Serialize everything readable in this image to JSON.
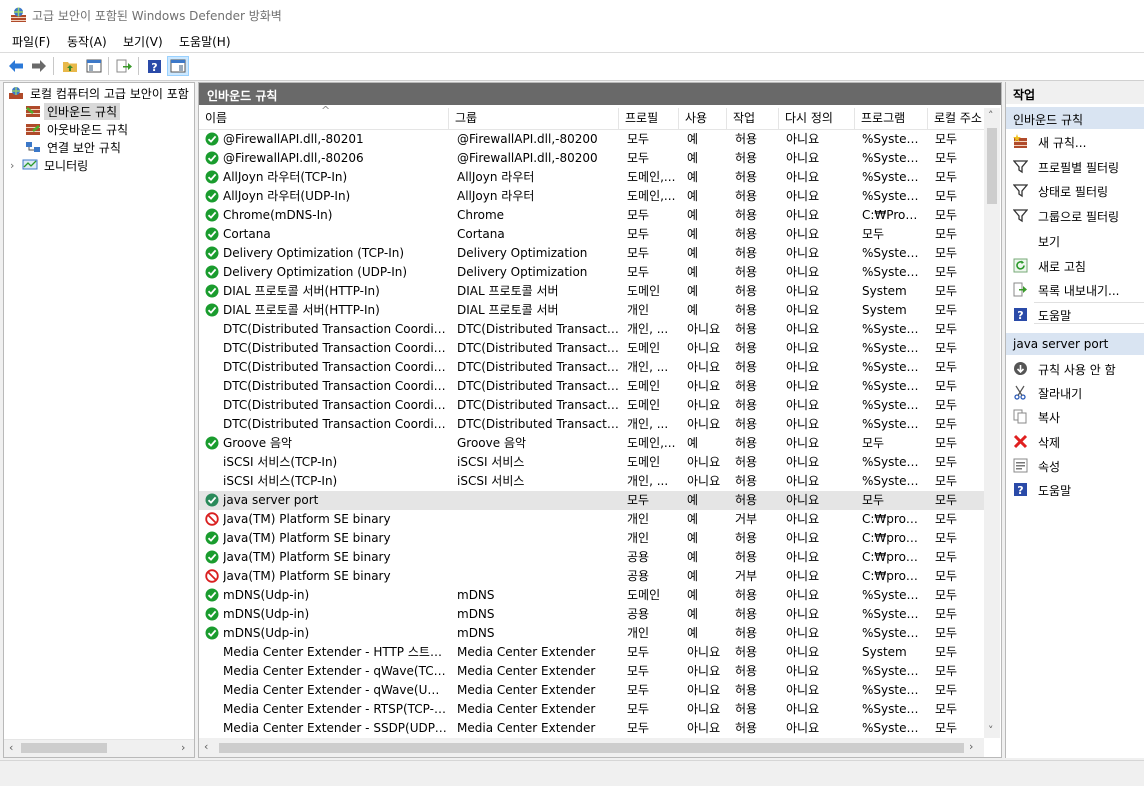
{
  "window": {
    "title": "고급 보안이 포함된 Windows Defender 방화벽"
  },
  "menu": [
    {
      "key": "file",
      "label": "파일(F)"
    },
    {
      "key": "action",
      "label": "동작(A)"
    },
    {
      "key": "view",
      "label": "보기(V)"
    },
    {
      "key": "help",
      "label": "도움말(H)"
    }
  ],
  "tree": {
    "root": "로컬 컴퓨터의 고급 보안이 포함",
    "items": [
      {
        "key": "inbound",
        "label": "인바운드 규칙",
        "selected": true
      },
      {
        "key": "outbound",
        "label": "아웃바운드 규칙"
      },
      {
        "key": "connection",
        "label": "연결 보안 규칙"
      },
      {
        "key": "monitoring",
        "label": "모니터링"
      }
    ]
  },
  "center": {
    "title": "인바운드 규칙",
    "columns": [
      {
        "key": "name",
        "label": "이름"
      },
      {
        "key": "group",
        "label": "그룹"
      },
      {
        "key": "profile",
        "label": "프로필"
      },
      {
        "key": "enabled",
        "label": "사용"
      },
      {
        "key": "action",
        "label": "작업"
      },
      {
        "key": "override",
        "label": "다시 정의"
      },
      {
        "key": "program",
        "label": "프로그램"
      },
      {
        "key": "local",
        "label": "로컬 주소"
      }
    ],
    "rows": [
      {
        "s": "ok",
        "name": "@FirewallAPI.dll,-80201",
        "group": "@FirewallAPI.dll,-80200",
        "profile": "모두",
        "enabled": "예",
        "action": "허용",
        "override": "아니요",
        "program": "%System...",
        "local": "모두"
      },
      {
        "s": "ok",
        "name": "@FirewallAPI.dll,-80206",
        "group": "@FirewallAPI.dll,-80200",
        "profile": "모두",
        "enabled": "예",
        "action": "허용",
        "override": "아니요",
        "program": "%System...",
        "local": "모두"
      },
      {
        "s": "ok",
        "name": "AllJoyn 라우터(TCP-In)",
        "group": "AllJoyn 라우터",
        "profile": "도메인,...",
        "enabled": "예",
        "action": "허용",
        "override": "아니요",
        "program": "%System...",
        "local": "모두"
      },
      {
        "s": "ok",
        "name": "AllJoyn 라우터(UDP-In)",
        "group": "AllJoyn 라우터",
        "profile": "도메인,...",
        "enabled": "예",
        "action": "허용",
        "override": "아니요",
        "program": "%System...",
        "local": "모두"
      },
      {
        "s": "ok",
        "name": "Chrome(mDNS-In)",
        "group": "Chrome",
        "profile": "모두",
        "enabled": "예",
        "action": "허용",
        "override": "아니요",
        "program": "C:₩Progr...",
        "local": "모두"
      },
      {
        "s": "ok",
        "name": "Cortana",
        "group": "Cortana",
        "profile": "모두",
        "enabled": "예",
        "action": "허용",
        "override": "아니요",
        "program": "모두",
        "local": "모두"
      },
      {
        "s": "ok",
        "name": "Delivery Optimization (TCP-In)",
        "group": "Delivery Optimization",
        "profile": "모두",
        "enabled": "예",
        "action": "허용",
        "override": "아니요",
        "program": "%System...",
        "local": "모두"
      },
      {
        "s": "ok",
        "name": "Delivery Optimization (UDP-In)",
        "group": "Delivery Optimization",
        "profile": "모두",
        "enabled": "예",
        "action": "허용",
        "override": "아니요",
        "program": "%System...",
        "local": "모두"
      },
      {
        "s": "ok",
        "name": "DIAL 프로토콜 서버(HTTP-In)",
        "group": "DIAL 프로토콜 서버",
        "profile": "도메인",
        "enabled": "예",
        "action": "허용",
        "override": "아니요",
        "program": "System",
        "local": "모두"
      },
      {
        "s": "ok",
        "name": "DIAL 프로토콜 서버(HTTP-In)",
        "group": "DIAL 프로토콜 서버",
        "profile": "개인",
        "enabled": "예",
        "action": "허용",
        "override": "아니요",
        "program": "System",
        "local": "모두"
      },
      {
        "s": "none",
        "name": "DTC(Distributed Transaction Coordinato...",
        "group": "DTC(Distributed Transactio...",
        "profile": "개인, ...",
        "enabled": "아니요",
        "action": "허용",
        "override": "아니요",
        "program": "%System...",
        "local": "모두"
      },
      {
        "s": "none",
        "name": "DTC(Distributed Transaction Coordinato...",
        "group": "DTC(Distributed Transactio...",
        "profile": "도메인",
        "enabled": "아니요",
        "action": "허용",
        "override": "아니요",
        "program": "%System...",
        "local": "모두"
      },
      {
        "s": "none",
        "name": "DTC(Distributed Transaction Coordinato...",
        "group": "DTC(Distributed Transactio...",
        "profile": "개인, ...",
        "enabled": "아니요",
        "action": "허용",
        "override": "아니요",
        "program": "%System...",
        "local": "모두"
      },
      {
        "s": "none",
        "name": "DTC(Distributed Transaction Coordinato...",
        "group": "DTC(Distributed Transactio...",
        "profile": "도메인",
        "enabled": "아니요",
        "action": "허용",
        "override": "아니요",
        "program": "%System...",
        "local": "모두"
      },
      {
        "s": "none",
        "name": "DTC(Distributed Transaction Coordinato...",
        "group": "DTC(Distributed Transactio...",
        "profile": "도메인",
        "enabled": "아니요",
        "action": "허용",
        "override": "아니요",
        "program": "%System...",
        "local": "모두"
      },
      {
        "s": "none",
        "name": "DTC(Distributed Transaction Coordinato...",
        "group": "DTC(Distributed Transactio...",
        "profile": "개인, ...",
        "enabled": "아니요",
        "action": "허용",
        "override": "아니요",
        "program": "%System...",
        "local": "모두"
      },
      {
        "s": "ok",
        "name": "Groove 음악",
        "group": "Groove 음악",
        "profile": "도메인,...",
        "enabled": "예",
        "action": "허용",
        "override": "아니요",
        "program": "모두",
        "local": "모두"
      },
      {
        "s": "none",
        "name": "iSCSI 서비스(TCP-In)",
        "group": "iSCSI 서비스",
        "profile": "도메인",
        "enabled": "아니요",
        "action": "허용",
        "override": "아니요",
        "program": "%System...",
        "local": "모두"
      },
      {
        "s": "none",
        "name": "iSCSI 서비스(TCP-In)",
        "group": "iSCSI 서비스",
        "profile": "개인, ...",
        "enabled": "아니요",
        "action": "허용",
        "override": "아니요",
        "program": "%System...",
        "local": "모두"
      },
      {
        "s": "sel",
        "name": "java server port",
        "group": "",
        "profile": "모두",
        "enabled": "예",
        "action": "허용",
        "override": "아니요",
        "program": "모두",
        "local": "모두"
      },
      {
        "s": "block",
        "name": "Java(TM) Platform SE binary",
        "group": "",
        "profile": "개인",
        "enabled": "예",
        "action": "거부",
        "override": "아니요",
        "program": "C:₩progr...",
        "local": "모두"
      },
      {
        "s": "ok",
        "name": "Java(TM) Platform SE binary",
        "group": "",
        "profile": "개인",
        "enabled": "예",
        "action": "허용",
        "override": "아니요",
        "program": "C:₩progr...",
        "local": "모두"
      },
      {
        "s": "ok",
        "name": "Java(TM) Platform SE binary",
        "group": "",
        "profile": "공용",
        "enabled": "예",
        "action": "허용",
        "override": "아니요",
        "program": "C:₩progr...",
        "local": "모두"
      },
      {
        "s": "block",
        "name": "Java(TM) Platform SE binary",
        "group": "",
        "profile": "공용",
        "enabled": "예",
        "action": "거부",
        "override": "아니요",
        "program": "C:₩progr...",
        "local": "모두"
      },
      {
        "s": "ok",
        "name": "mDNS(Udp-in)",
        "group": "mDNS",
        "profile": "도메인",
        "enabled": "예",
        "action": "허용",
        "override": "아니요",
        "program": "%System...",
        "local": "모두"
      },
      {
        "s": "ok",
        "name": "mDNS(Udp-in)",
        "group": "mDNS",
        "profile": "공용",
        "enabled": "예",
        "action": "허용",
        "override": "아니요",
        "program": "%System...",
        "local": "모두"
      },
      {
        "s": "ok",
        "name": "mDNS(Udp-in)",
        "group": "mDNS",
        "profile": "개인",
        "enabled": "예",
        "action": "허용",
        "override": "아니요",
        "program": "%System...",
        "local": "모두"
      },
      {
        "s": "none",
        "name": "Media Center Extender - HTTP 스트리밍...",
        "group": "Media Center Extender",
        "profile": "모두",
        "enabled": "아니요",
        "action": "허용",
        "override": "아니요",
        "program": "System",
        "local": "모두"
      },
      {
        "s": "none",
        "name": "Media Center Extender - qWave(TCP-In)",
        "group": "Media Center Extender",
        "profile": "모두",
        "enabled": "아니요",
        "action": "허용",
        "override": "아니요",
        "program": "%System...",
        "local": "모두"
      },
      {
        "s": "none",
        "name": "Media Center Extender - qWave(UDP-In)",
        "group": "Media Center Extender",
        "profile": "모두",
        "enabled": "아니요",
        "action": "허용",
        "override": "아니요",
        "program": "%System...",
        "local": "모두"
      },
      {
        "s": "none",
        "name": "Media Center Extender - RTSP(TCP-In)",
        "group": "Media Center Extender",
        "profile": "모두",
        "enabled": "아니요",
        "action": "허용",
        "override": "아니요",
        "program": "%System...",
        "local": "모두"
      },
      {
        "s": "none",
        "name": "Media Center Extender - SSDP(UDP-In)",
        "group": "Media Center Extender",
        "profile": "모두",
        "enabled": "아니요",
        "action": "허용",
        "override": "아니요",
        "program": "%System...",
        "local": "모두"
      }
    ]
  },
  "actions": {
    "title": "작업",
    "section1": "인바운드 규칙",
    "items1": [
      {
        "key": "new-rule",
        "label": "새 규칙...",
        "icon": "new-rule-icon"
      },
      {
        "key": "filter-profile",
        "label": "프로필별 필터링",
        "icon": "filter-icon"
      },
      {
        "key": "filter-state",
        "label": "상태로 필터링",
        "icon": "filter-icon"
      },
      {
        "key": "filter-group",
        "label": "그룹으로 필터링",
        "icon": "filter-icon"
      },
      {
        "key": "view",
        "label": "보기",
        "icon": ""
      },
      {
        "key": "refresh",
        "label": "새로 고침",
        "icon": "refresh-icon"
      },
      {
        "key": "export",
        "label": "목록 내보내기...",
        "icon": "export-icon"
      },
      {
        "key": "help",
        "label": "도움말",
        "icon": "help-icon"
      }
    ],
    "section2": "java server port",
    "items2": [
      {
        "key": "disable",
        "label": "규칙 사용 안 함",
        "icon": "disable-icon"
      },
      {
        "key": "cut",
        "label": "잘라내기",
        "icon": "cut-icon"
      },
      {
        "key": "copy",
        "label": "복사",
        "icon": "copy-icon"
      },
      {
        "key": "delete",
        "label": "삭제",
        "icon": "delete-icon"
      },
      {
        "key": "properties",
        "label": "속성",
        "icon": "properties-icon"
      },
      {
        "key": "help2",
        "label": "도움말",
        "icon": "help-icon"
      }
    ]
  },
  "colors": {
    "ok": "#1a9c2e",
    "block": "#d92020",
    "header": "#696969",
    "sectionBg": "#d9e4f2",
    "selectedRow": "#e5e5e5"
  }
}
